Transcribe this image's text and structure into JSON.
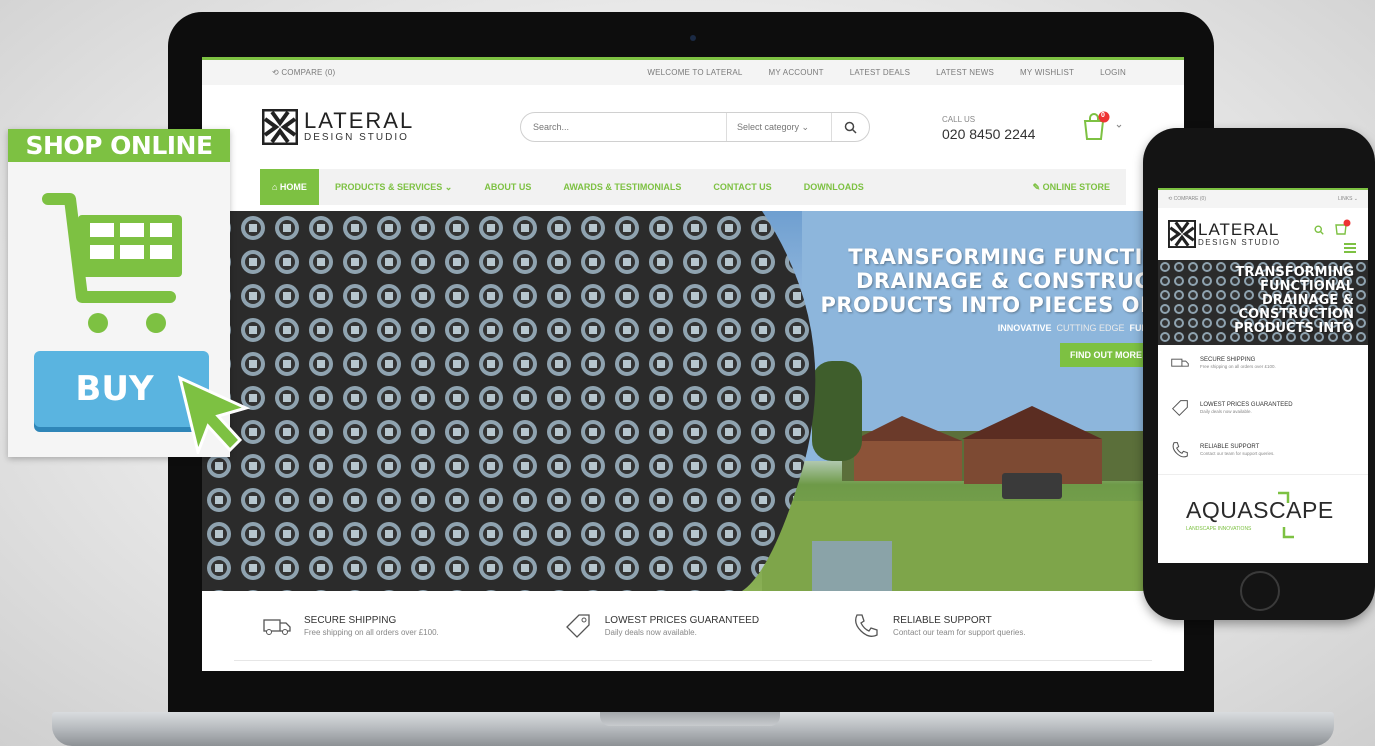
{
  "colors": {
    "accent": "#7dc142",
    "buy": "#5ab4e0"
  },
  "topbar": {
    "compare": "⟲ COMPARE (0)",
    "links": [
      "WELCOME TO LATERAL",
      "MY ACCOUNT",
      "LATEST DEALS",
      "LATEST NEWS",
      "MY WISHLIST",
      "LOGIN"
    ]
  },
  "logo": {
    "title": "LATERAL",
    "subtitle": "DESIGN STUDIO"
  },
  "search": {
    "placeholder": "Search...",
    "category": "Select category ⌄"
  },
  "call": {
    "label": "CALL US",
    "number": "020 8450 2244"
  },
  "cart": {
    "count": "0"
  },
  "nav": {
    "home": "⌂ HOME",
    "items": [
      "PRODUCTS & SERVICES ⌄",
      "ABOUT US",
      "AWARDS & TESTIMONIALS",
      "CONTACT US",
      "DOWNLOADS"
    ],
    "store": "✎ ONLINE STORE"
  },
  "hero": {
    "line1": "TRANSFORMING FUNCTIONAL",
    "line2": "DRAINAGE & CONSTRUCTION",
    "line3": "PRODUCTS INTO PIECES OF ART",
    "sub1": "INNOVATIVE",
    "sub2": "CUTTING EDGE",
    "sub3": "FUNCTIONAL",
    "button": "FIND OUT MORE"
  },
  "features": [
    {
      "title": "SECURE SHIPPING",
      "desc": "Free shipping on all orders over £100."
    },
    {
      "title": "LOWEST PRICES GUARANTEED",
      "desc": "Daily deals now available."
    },
    {
      "title": "RELIABLE SUPPORT",
      "desc": "Contact our team for support queries."
    }
  ],
  "badge": {
    "header": "SHOP ONLINE",
    "button": "BUY"
  },
  "phone": {
    "compare": "⟲ COMPARE (0)",
    "links": "LINKS ⌄",
    "hero": [
      "TRANSFORMING",
      "FUNCTIONAL",
      "DRAINAGE &",
      "CONSTRUCTION",
      "PRODUCTS INTO"
    ],
    "features": [
      {
        "title": "SECURE SHIPPING",
        "desc": "Free shipping on all orders over £100."
      },
      {
        "title": "LOWEST PRICES GUARANTEED",
        "desc": "Daily deals now available."
      },
      {
        "title": "RELIABLE SUPPORT",
        "desc": "Contact our team for support queries."
      }
    ],
    "brand": "AQUASCAPE",
    "brand_sub": "LANDSCAPE INNOVATIONS"
  }
}
